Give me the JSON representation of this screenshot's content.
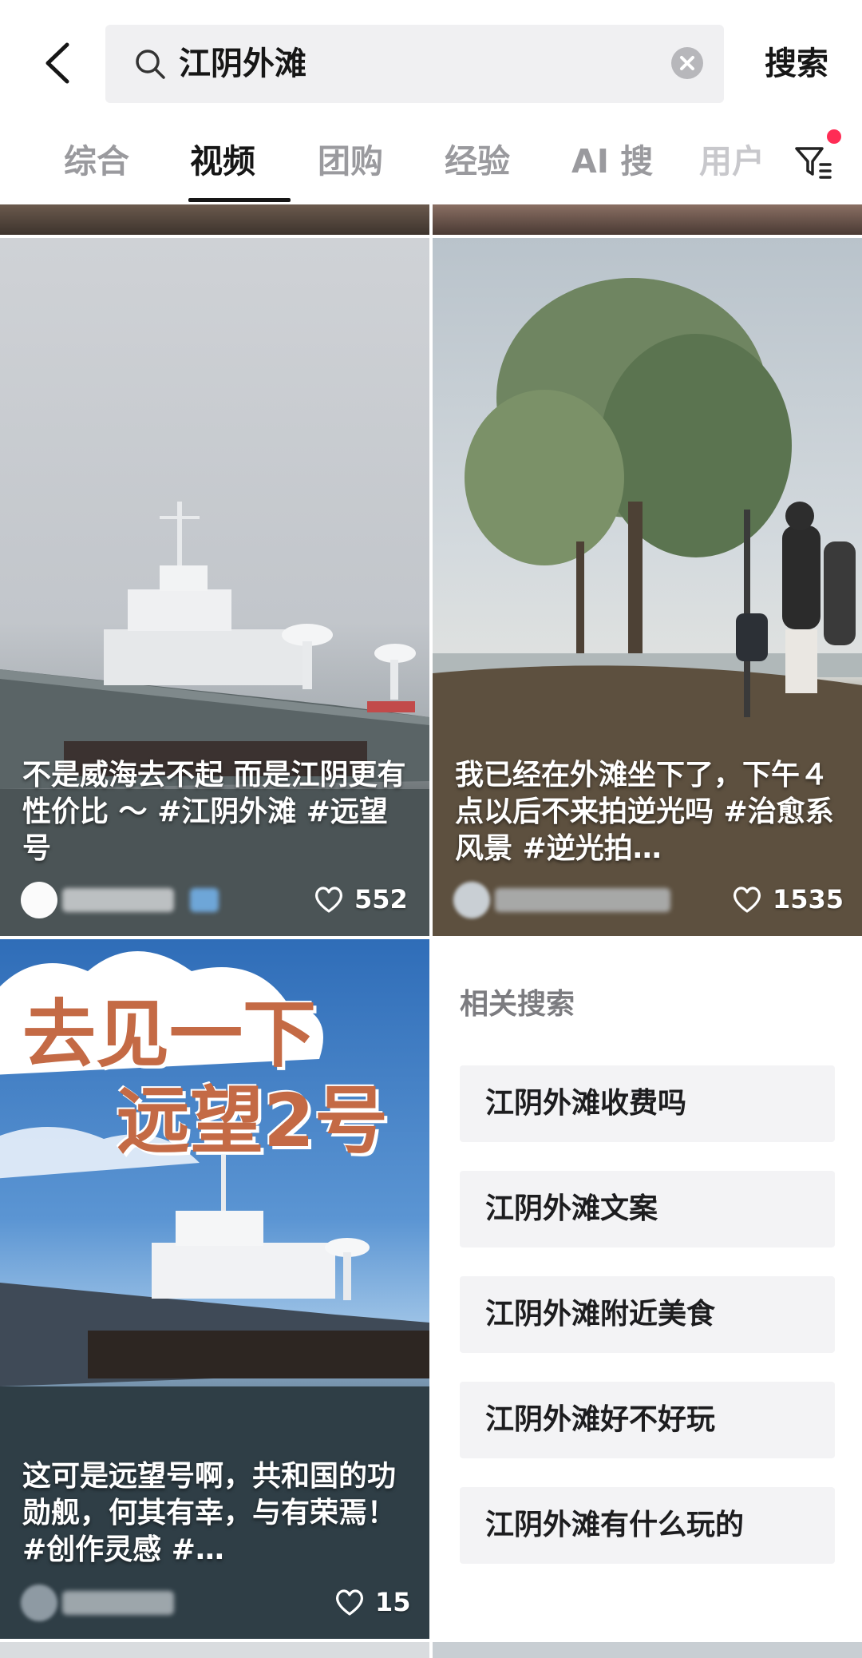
{
  "search": {
    "query": "江阴外滩",
    "button_label": "搜索"
  },
  "tabs": [
    {
      "label": "综合"
    },
    {
      "label": "视频",
      "active": true
    },
    {
      "label": "团购"
    },
    {
      "label": "经验"
    },
    {
      "label": "AI 搜"
    },
    {
      "label": "用户"
    }
  ],
  "results": [
    {
      "caption": "不是威海去不起 而是江阴更有性价比 ～ #江阴外滩 #远望号",
      "likes": "552"
    },
    {
      "caption": "我已经在外滩坐下了，下午４点以后不来拍逆光吗 #治愈系风景 #逆光拍…",
      "likes": "1535"
    },
    {
      "cover_title_line1": "去见一下",
      "cover_title_line2": "远望2号",
      "caption": "这可是远望号啊，共和国的功勋舰，何其有幸，与有荣焉！#创作灵感 #…",
      "likes": "15"
    }
  ],
  "related": {
    "title": "相关搜索",
    "items": [
      "江阴外滩收费吗",
      "江阴外滩文案",
      "江阴外滩附近美食",
      "江阴外滩好不好玩",
      "江阴外滩有什么玩的"
    ]
  },
  "colors": {
    "accent_dot": "#ff2c55",
    "search_bg": "#f0f0f2",
    "related_bg": "#f3f3f5"
  }
}
